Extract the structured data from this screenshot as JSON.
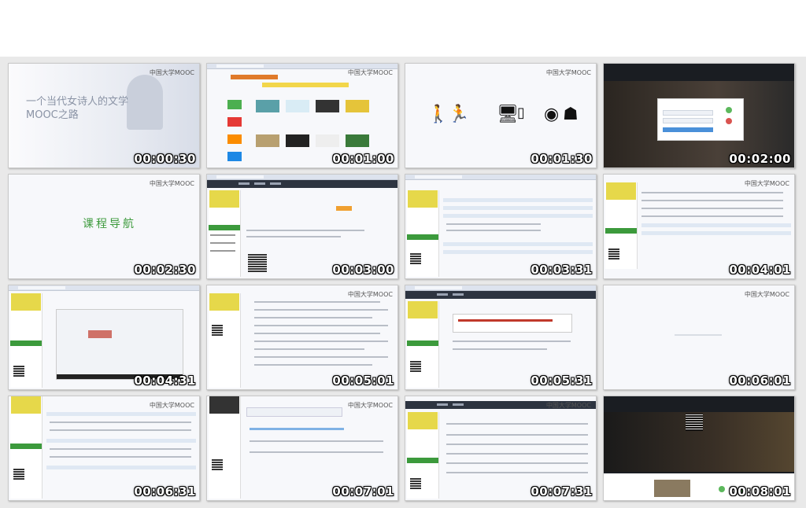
{
  "sheet": {
    "thumbnails": [
      {
        "timestamp": "00:00:30",
        "watermark": "中国大学MOOC",
        "slide_title": "一个当代女诗人的文学MOOC之路"
      },
      {
        "timestamp": "00:01:00",
        "watermark": "中国大学MOOC"
      },
      {
        "timestamp": "00:01:30",
        "watermark": "中国大学MOOC"
      },
      {
        "timestamp": "00:02:00"
      },
      {
        "timestamp": "00:02:30",
        "watermark": "中国大学MOOC",
        "slide_title": "课程导航"
      },
      {
        "timestamp": "00:03:00"
      },
      {
        "timestamp": "00:03:31"
      },
      {
        "timestamp": "00:04:01",
        "watermark": "中国大学MOOC"
      },
      {
        "timestamp": "00:04:31"
      },
      {
        "timestamp": "00:05:01",
        "watermark": "中国大学MOOC"
      },
      {
        "timestamp": "00:05:31"
      },
      {
        "timestamp": "00:06:01",
        "watermark": "中国大学MOOC"
      },
      {
        "timestamp": "00:06:31",
        "watermark": "中国大学MOOC"
      },
      {
        "timestamp": "00:07:01",
        "watermark": "中国大学MOOC"
      },
      {
        "timestamp": "00:07:31",
        "watermark": "中国大学MOOC"
      },
      {
        "timestamp": "00:08:01"
      }
    ]
  },
  "colors": {
    "sheet_bg": "#e9e9e9",
    "accent_green": "#3c9a3c",
    "logo_yellow": "#e6d84a",
    "orange": "#f0a030",
    "dark_nav": "#2d3440"
  }
}
